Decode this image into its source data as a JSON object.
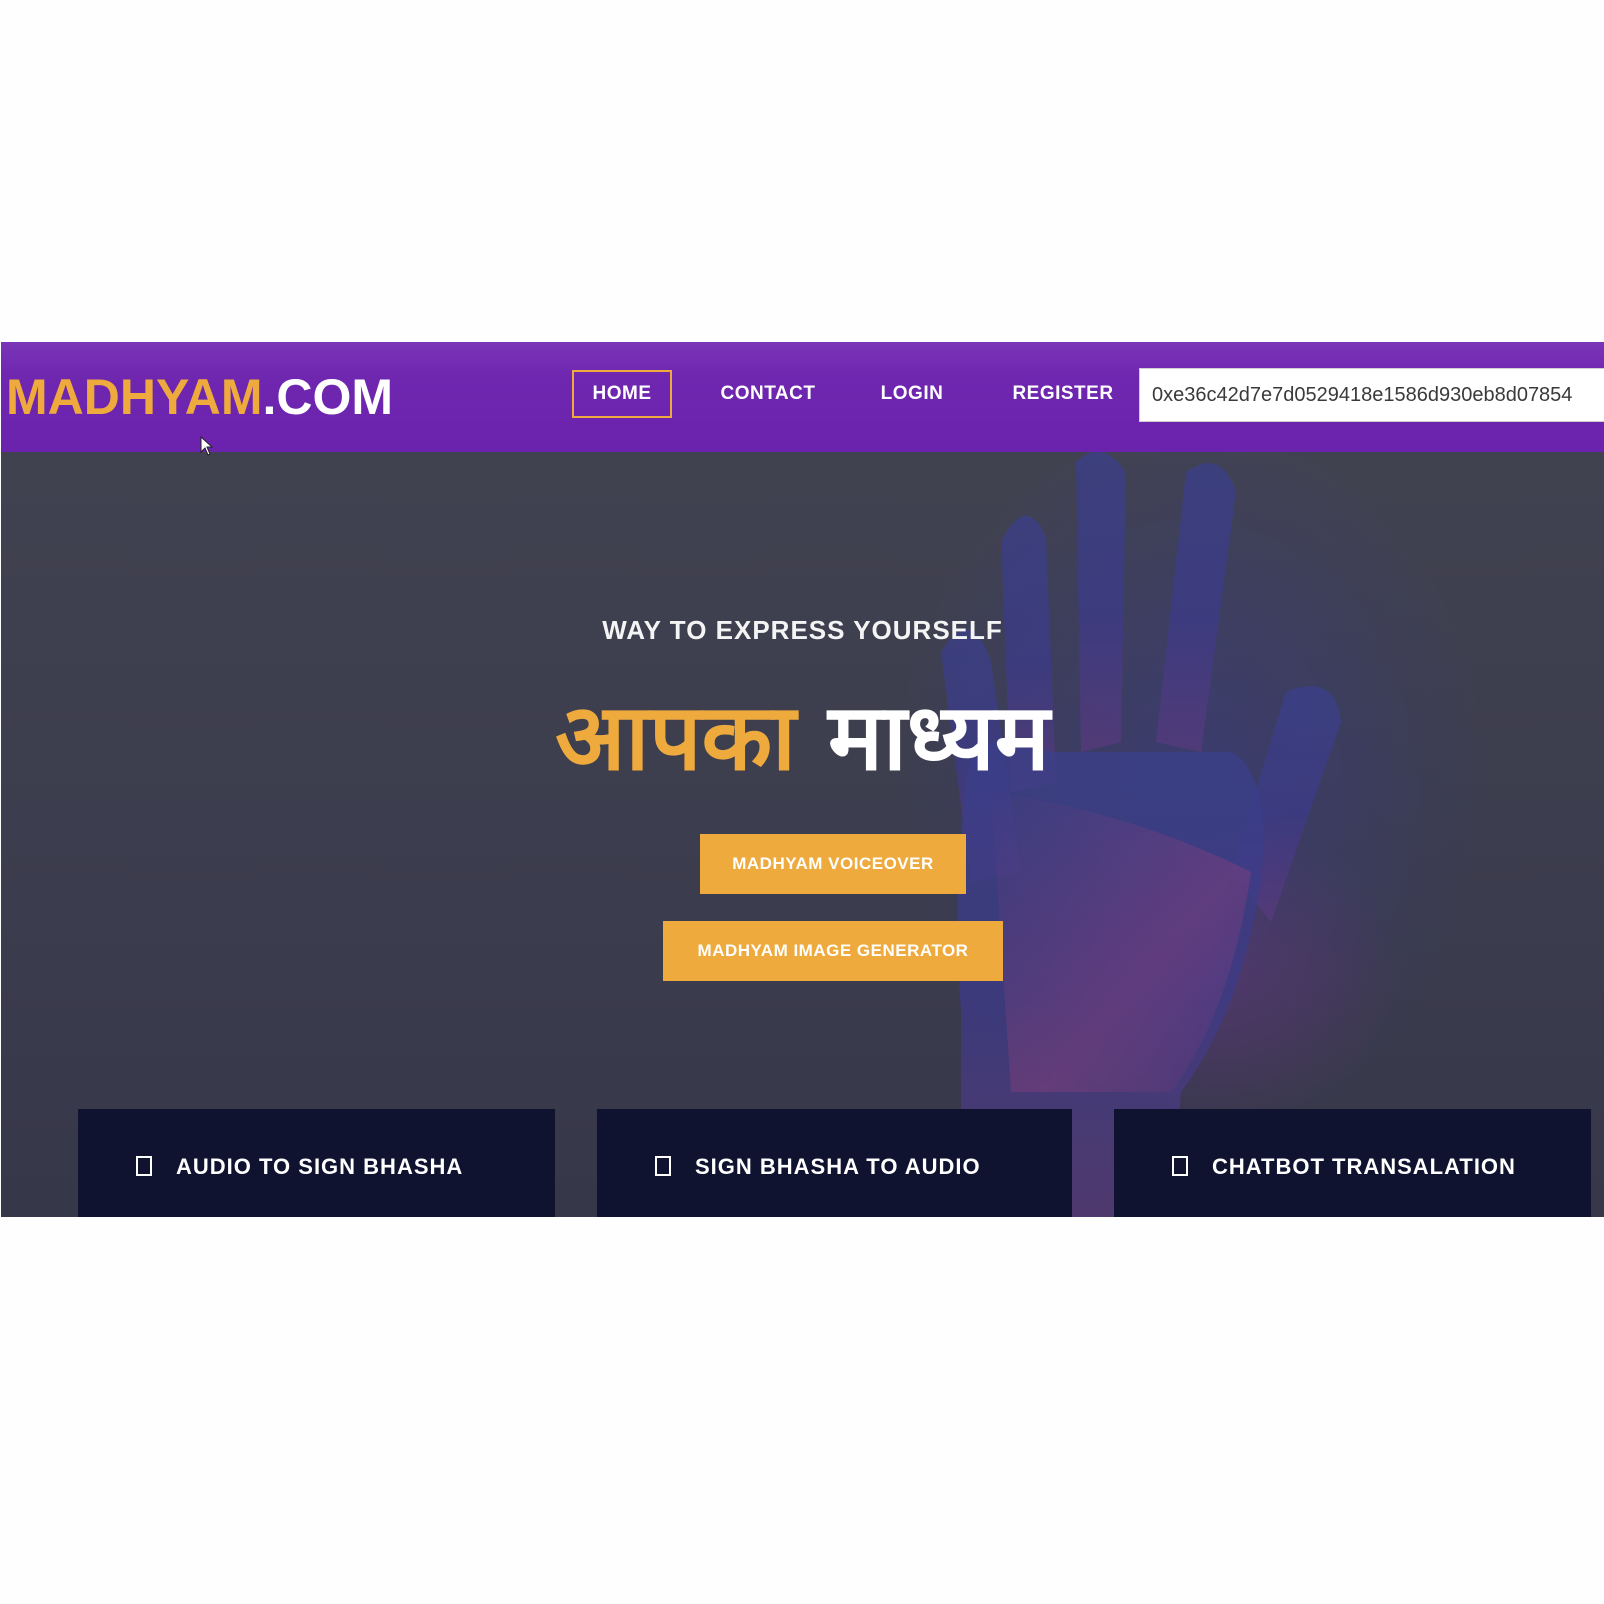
{
  "navbar": {
    "logo_accent": "MADHYAM",
    "logo_suffix": ".COM",
    "items": [
      {
        "label": "HOME",
        "active": true
      },
      {
        "label": "CONTACT"
      },
      {
        "label": "LOGIN"
      },
      {
        "label": "REGISTER"
      }
    ],
    "wallet_address": "0xe36c42d7e7d0529418e1586d930eb8d07854"
  },
  "hero": {
    "tagline": "WAY TO EXPRESS YOURSELF",
    "headline_accent": "आपका",
    "headline_white": "माध्यम",
    "buttons": {
      "voiceover": "MADHYAM VOICEOVER",
      "image_generator": "MADHYAM IMAGE GENERATOR"
    }
  },
  "features": [
    {
      "label": "AUDIO TO SIGN BHASHA",
      "icon": "square-outline-icon"
    },
    {
      "label": "SIGN BHASHA TO AUDIO",
      "icon": "square-outline-icon"
    },
    {
      "label": "CHATBOT TRANSALATION",
      "icon": "square-outline-icon"
    }
  ],
  "colors": {
    "navbar_purple": "#6f27b0",
    "accent_orange": "#eeaa3c",
    "hero_bg": "#3f4050",
    "card_bg": "#0f1330"
  }
}
